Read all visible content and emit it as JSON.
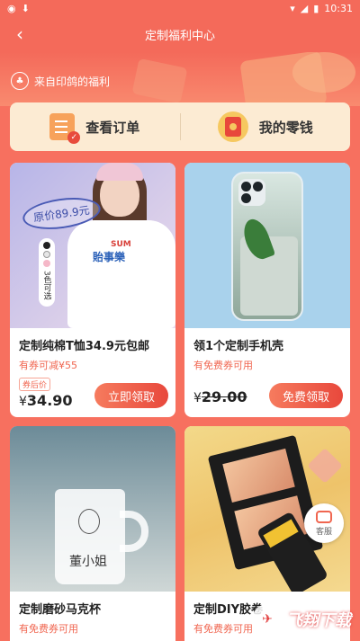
{
  "status_bar": {
    "time": "10:31"
  },
  "nav": {
    "title": "定制福利中心"
  },
  "welfare": {
    "label": "来自印鸽的福利"
  },
  "quick": {
    "orders_label": "查看订单",
    "wallet_label": "我的零钱"
  },
  "products": [
    {
      "title": "定制纯棉T恤34.9元包邮",
      "subtitle": "有券可减¥55",
      "after_tag": "券后价",
      "currency": "¥",
      "price": "34.90",
      "price_struck": false,
      "button": "立即领取",
      "image_badge": "原价89.9元",
      "colors_text": "3色可选",
      "shirt_logo": "SUM",
      "shirt_logo2": "貽事樂"
    },
    {
      "title": "领1个定制手机壳",
      "subtitle": "有免费券可用",
      "currency": "¥",
      "price": "29.00",
      "price_struck": true,
      "button": "免费领取"
    },
    {
      "title": "定制磨砂马克杯",
      "subtitle": "有免费券可用",
      "mug_text": "董小姐"
    },
    {
      "title": "定制DIY胶卷",
      "subtitle": "有免费券可用"
    }
  ],
  "service": {
    "label": "客服"
  },
  "watermark": {
    "text": "飞翔下载"
  },
  "colors": {
    "primary": "#f46a5a",
    "accent": "#e8483c",
    "quickbar_bg": "#fcebd3"
  }
}
